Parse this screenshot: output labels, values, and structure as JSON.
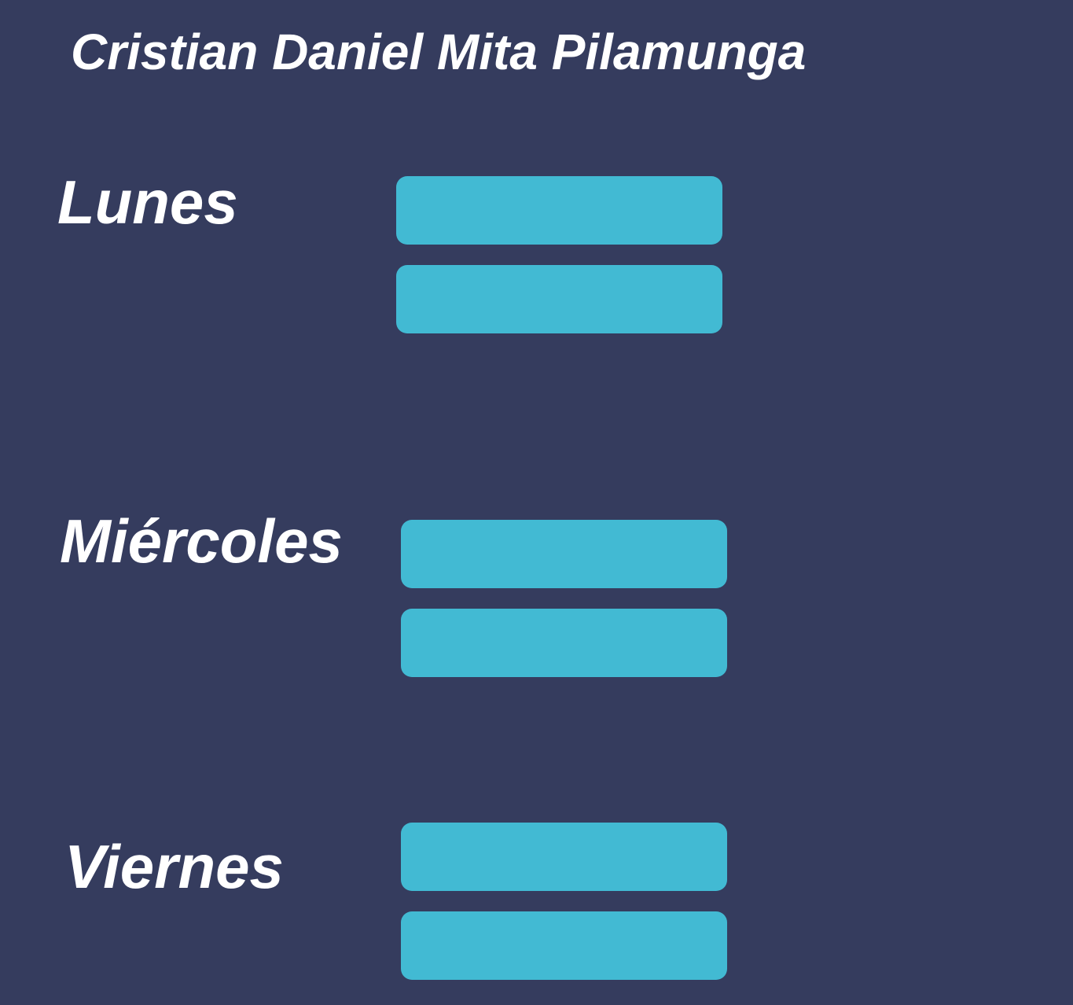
{
  "header": {
    "title": "Cristian Daniel Mita Pilamunga"
  },
  "schedule": {
    "days": [
      {
        "label": "Lunes"
      },
      {
        "label": "Miércoles"
      },
      {
        "label": "Viernes"
      }
    ]
  },
  "colors": {
    "background": "#353c5e",
    "slot": "#42bad3",
    "text": "#ffffff"
  }
}
